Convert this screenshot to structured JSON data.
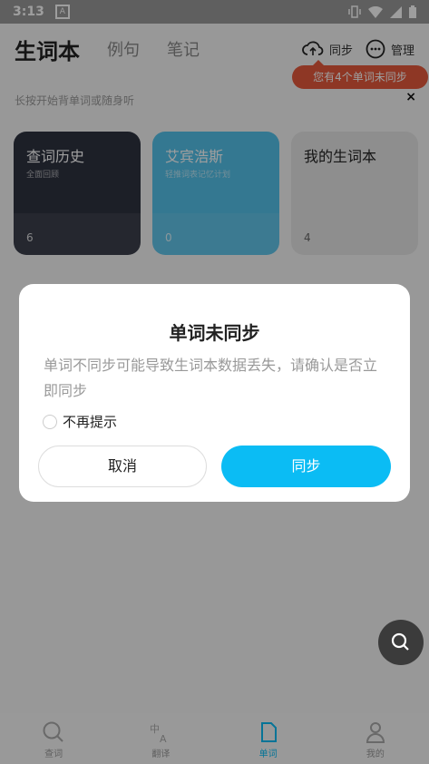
{
  "status": {
    "time": "3:13",
    "notif_icon": "A"
  },
  "header": {
    "tab_active": "生词本",
    "tabs": [
      "例句",
      "笔记"
    ],
    "sync_label": "同步",
    "manage_label": "管理",
    "badge": "您有4个单词未同步"
  },
  "hint": {
    "text": "长按开始背单词或随身听",
    "close": "×"
  },
  "cards": [
    {
      "title": "查词历史",
      "subtitle": "全面回顾",
      "count": "6"
    },
    {
      "title": "艾宾浩斯",
      "subtitle": "轻推词表记忆计划",
      "count": "0"
    },
    {
      "title": "我的生词本",
      "subtitle": "",
      "count": "4"
    }
  ],
  "dialog": {
    "title": "单词未同步",
    "message": "单词不同步可能导致生词本数据丢失，请确认是否立即同步",
    "checkbox_label": "不再提示",
    "cancel": "取消",
    "confirm": "同步"
  },
  "bottom_nav": [
    {
      "label": "查词",
      "icon": "search-icon"
    },
    {
      "label": "翻译",
      "icon": "translate-icon"
    },
    {
      "label": "单词",
      "icon": "word-icon"
    },
    {
      "label": "我的",
      "icon": "person-icon"
    }
  ],
  "colors": {
    "accent": "#0bbcf4",
    "badge": "#e55a3c"
  }
}
